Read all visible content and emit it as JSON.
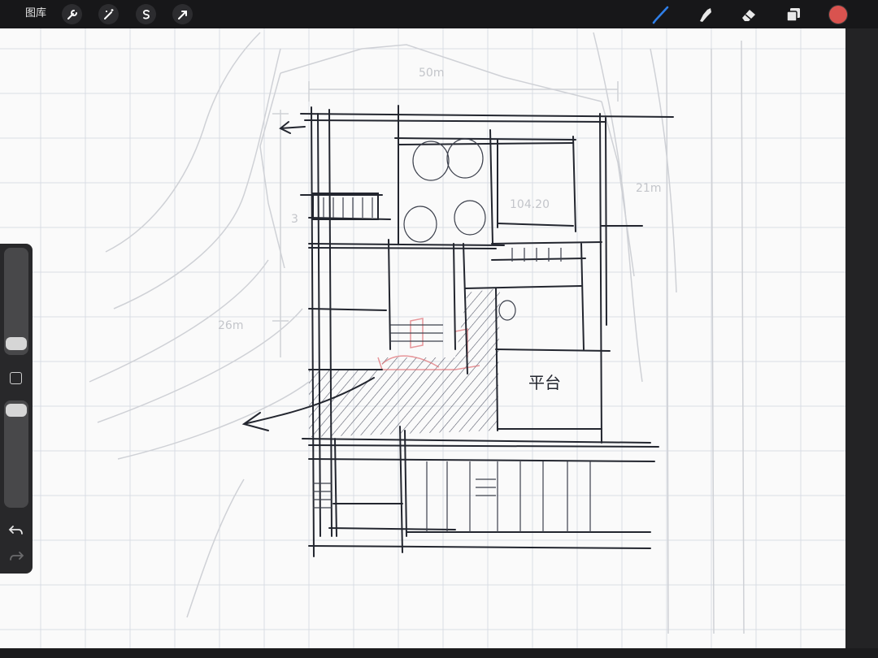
{
  "toolbar": {
    "gallery_label": "图库",
    "left_tools": [
      "wrench-icon",
      "magic-wand-icon",
      "selection-icon",
      "transform-arrow-icon"
    ],
    "right_tools": [
      "brush-icon",
      "smudge-icon",
      "eraser-icon",
      "layers-icon"
    ],
    "active_tool": "brush-icon",
    "current_color": "#d9534f"
  },
  "sidebar": {
    "brush_size_level": 0.2,
    "opacity_level": 0.97,
    "modify_button": "square-modify-icon",
    "undo": "undo-icon",
    "redo": "redo-icon"
  },
  "drawing": {
    "dimension_top": "50m",
    "dimension_right": "21m",
    "dimension_left": "26m",
    "left_small": "3",
    "elevation": "104.20",
    "room_label": "平台"
  }
}
